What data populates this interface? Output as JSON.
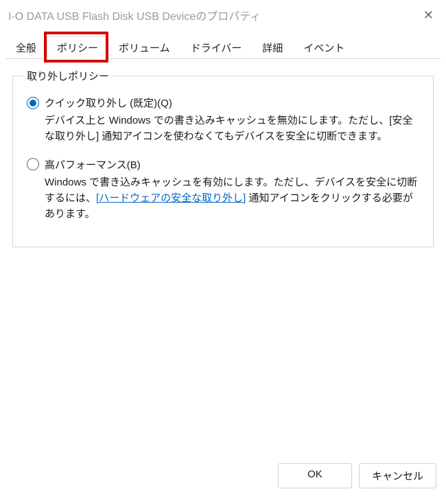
{
  "window": {
    "title": "I-O DATA USB Flash Disk USB Deviceのプロパティ",
    "close_glyph": "✕"
  },
  "tabs": [
    {
      "label": "全般"
    },
    {
      "label": "ポリシー",
      "active": true,
      "highlighted": true
    },
    {
      "label": "ボリューム"
    },
    {
      "label": "ドライバー"
    },
    {
      "label": "詳細"
    },
    {
      "label": "イベント"
    }
  ],
  "group": {
    "legend": "取り外しポリシー",
    "options": [
      {
        "id": "quick-removal",
        "checked": true,
        "label": "クイック取り外し (既定)(Q)",
        "desc_parts": [
          {
            "text": "デバイス上と Windows での書き込みキャッシュを無効にします。ただし、[安全な取り外し] 通知アイコンを使わなくてもデバイスを安全に切断できます。"
          }
        ]
      },
      {
        "id": "better-performance",
        "checked": false,
        "label": "高パフォーマンス(B)",
        "desc_parts": [
          {
            "text": "Windows で書き込みキャッシュを有効にします。ただし、デバイスを安全に切断するには、"
          },
          {
            "text": "[ハードウェアの安全な取り外し]",
            "link": true
          },
          {
            "text": " 通知アイコンをクリックする必要があります。"
          }
        ]
      }
    ]
  },
  "buttons": {
    "ok": "OK",
    "cancel": "キャンセル"
  }
}
